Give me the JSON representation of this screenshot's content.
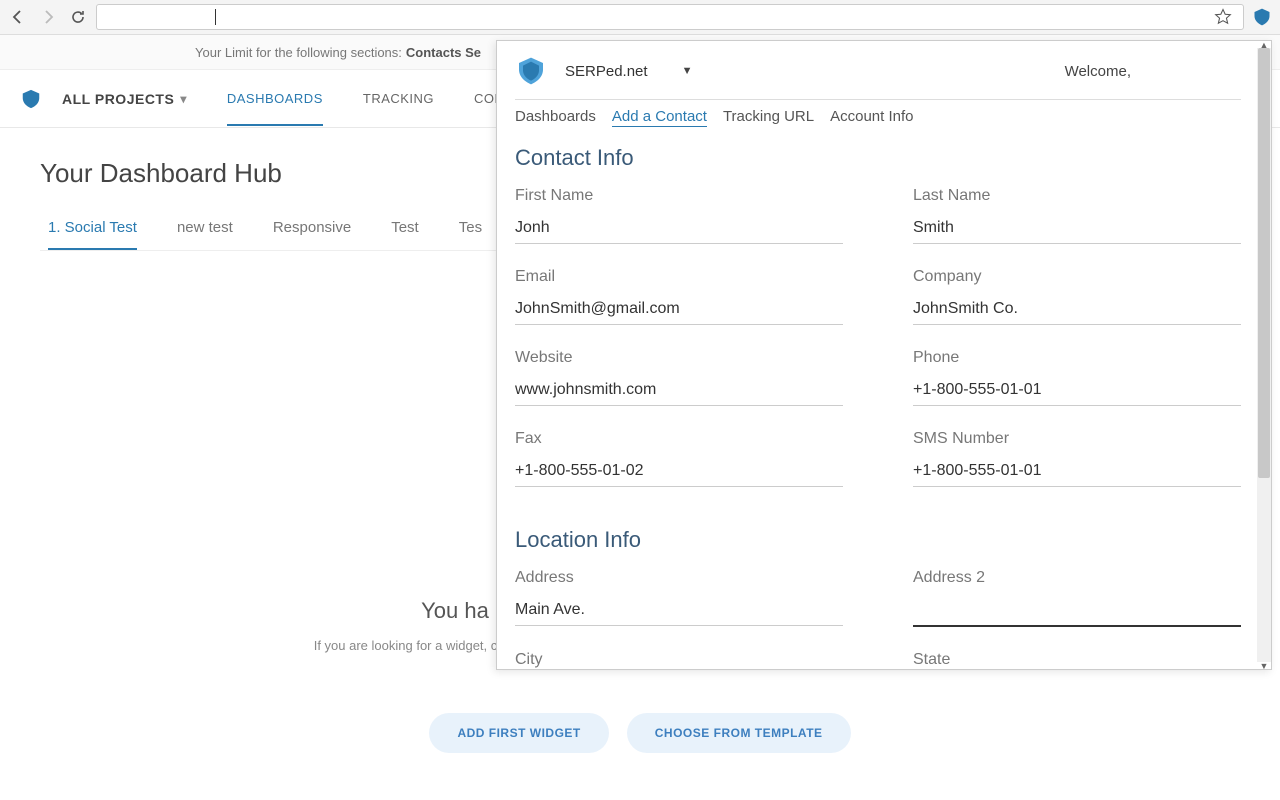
{
  "browser": {
    "address": ""
  },
  "limitBar": {
    "prefix": "Your Limit for the following sections:",
    "bold": "Contacts Se"
  },
  "nav": {
    "projects": "ALL PROJECTS",
    "tabs": [
      "DASHBOARDS",
      "TRACKING",
      "CONTAC"
    ]
  },
  "page": {
    "title": "Your Dashboard Hub",
    "subtabs": [
      "1. Social Test",
      "new test",
      "Responsive",
      "Test",
      "Tes"
    ]
  },
  "empty": {
    "title": "You ha",
    "sub": "If you are looking for a widget, change project, or use the settings button in the top-right corner to create a widget.",
    "btn1": "ADD FIRST WIDGET",
    "btn2": "CHOOSE FROM TEMPLATE"
  },
  "ext": {
    "brand": "SERPed.net",
    "welcome": "Welcome,",
    "tabs": [
      "Dashboards",
      "Add a Contact",
      "Tracking URL",
      "Account Info"
    ],
    "section1": "Contact Info",
    "section2": "Location Info",
    "fields": {
      "firstName": {
        "label": "First Name",
        "value": "Jonh"
      },
      "lastName": {
        "label": "Last Name",
        "value": "Smith"
      },
      "email": {
        "label": "Email",
        "value": "JohnSmith@gmail.com"
      },
      "company": {
        "label": "Company",
        "value": "JohnSmith Co."
      },
      "website": {
        "label": "Website",
        "value": "www.johnsmith.com"
      },
      "phone": {
        "label": "Phone",
        "value": "+1-800-555-01-01"
      },
      "fax": {
        "label": "Fax",
        "value": "+1-800-555-01-02"
      },
      "sms": {
        "label": "SMS Number",
        "value": "+1-800-555-01-01"
      },
      "address": {
        "label": "Address",
        "value": "Main Ave."
      },
      "address2": {
        "label": "Address 2",
        "value": ""
      },
      "city": {
        "label": "City",
        "value": ""
      },
      "state": {
        "label": "State",
        "value": ""
      }
    }
  }
}
